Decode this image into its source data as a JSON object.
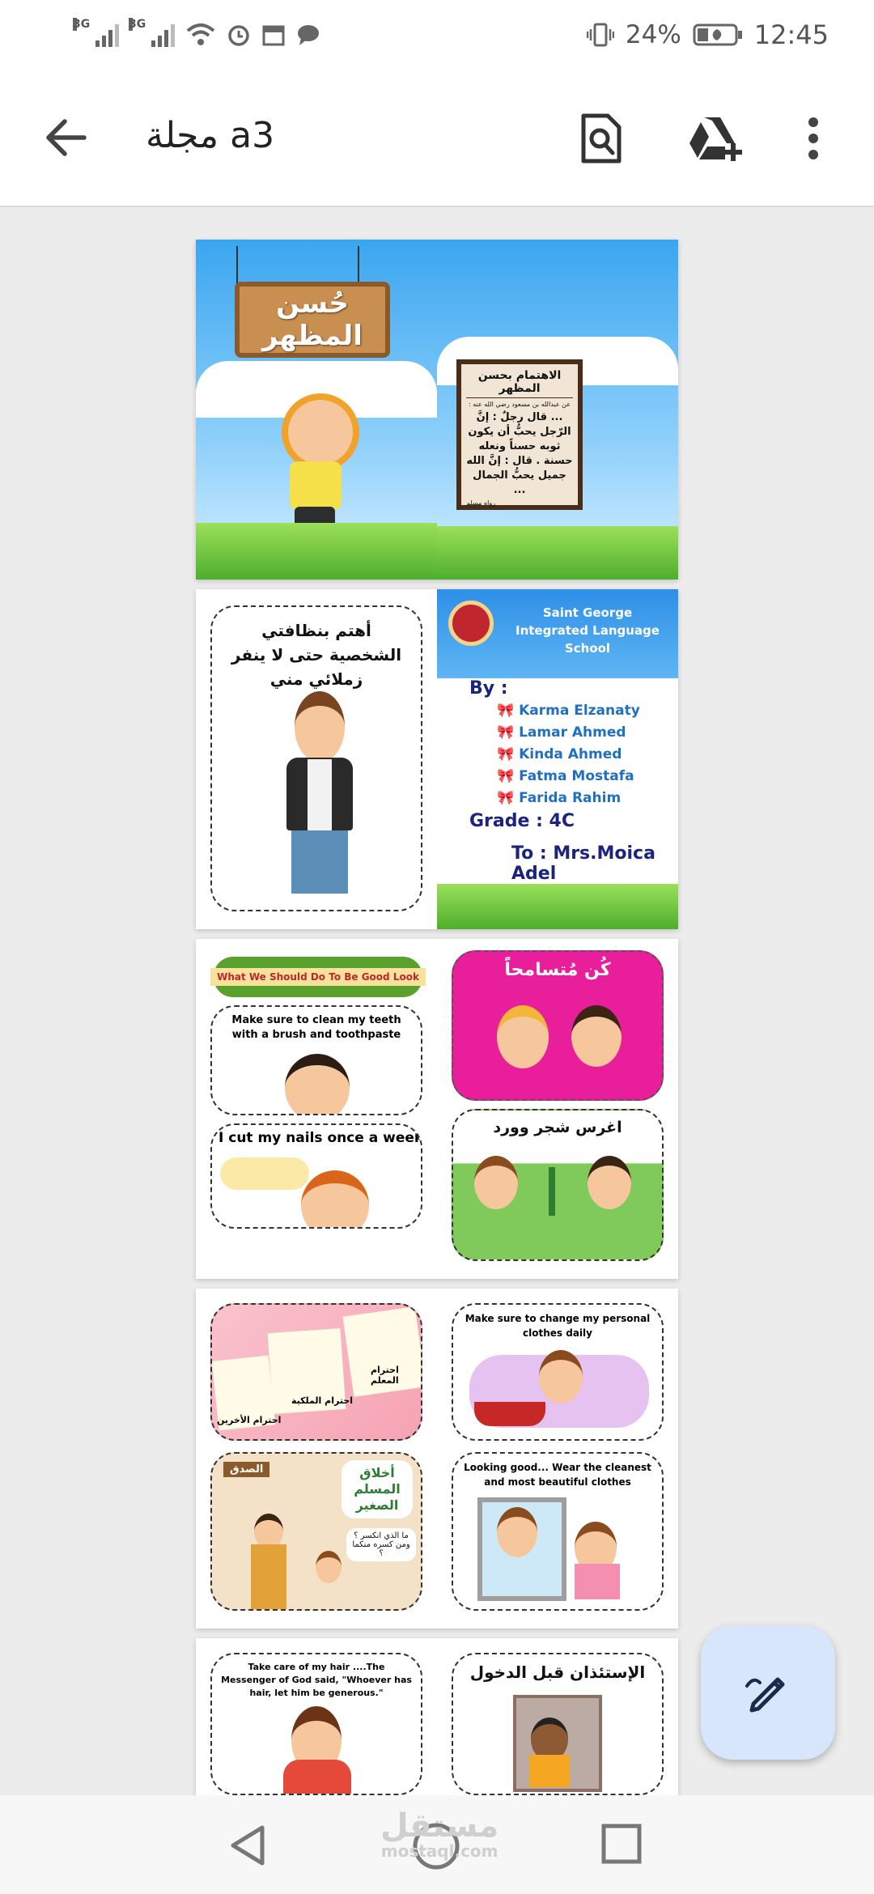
{
  "status_bar": {
    "network1": "3G",
    "network2": "3G",
    "battery": "24%",
    "time": "12:45"
  },
  "app_bar": {
    "title": "مجلة a3"
  },
  "pages": {
    "p1": {
      "sign_title": "حُسن المظهر",
      "board_title": "الاهتمام بحسن المظهر",
      "board_line1": "عن عبدالله بن مسعود رضي الله عنه :",
      "board_body": "... قال رجلٌ : إنَّ الرّجل يحبُّ أن يكون ثوبه حسناً ونعله حسنة . قال : إنَّ الله جميل يحبُّ الجمال ...",
      "board_source": "رواه مسلم"
    },
    "p2": {
      "card_text": "أهتم بنظافتي الشخصية حتى لا ينفر زملائي مني",
      "school_name": "Saint George Integrated Language School",
      "by_label": "By :",
      "authors": [
        "Karma Elzanaty",
        "Lamar Ahmed",
        "Kinda Ahmed",
        "Fatma Mostafa",
        "Farida Rahim"
      ],
      "grade": "Grade : 4C",
      "to": "To : Mrs.Moica Adel"
    },
    "p3": {
      "banner": "What We Should Do To Be Good Look",
      "card1": "Make sure to clean my teeth with a brush and toothpaste",
      "card2": "I cut my nails once a week",
      "card3": "كُن مُتسامحاً",
      "card4": "اغرس شجر وورد"
    },
    "p4": {
      "card1_labels": [
        "احترام الأخرين",
        "احترام الملكية",
        "احترام المعلم"
      ],
      "card2_title": "أخلاق المسلم الصغير",
      "card2_label": "الصدق",
      "card2_q": "ما الذي انكسر ؟ ومن كسره منكما ؟",
      "card3": "Make sure to change my personal clothes daily",
      "card4": "Looking good... Wear the cleanest and most beautiful clothes"
    },
    "p5": {
      "card1": "Take care of my hair ....The Messenger of God said, \"Whoever has hair, let him be generous.\"",
      "card2": "الإستئذان قبل الدخول"
    }
  },
  "watermark": {
    "ar": "مستقل",
    "en": "mostaql.com"
  },
  "colors": {
    "fab_bg": "#d8e6fb",
    "accent_blue": "#1f6fc2",
    "magenta": "#e6198a"
  }
}
